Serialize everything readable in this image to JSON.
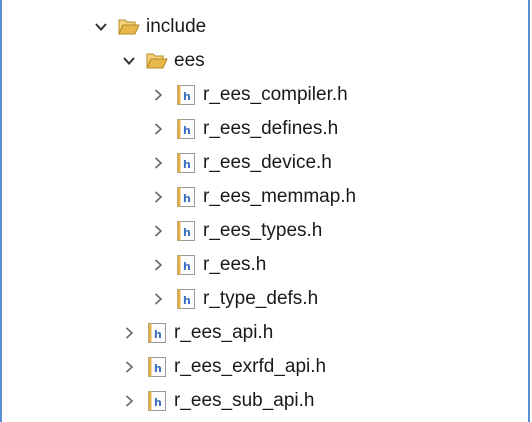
{
  "tree": {
    "folder_include": "include",
    "folder_ees": "ees",
    "ees_files": [
      "r_ees_compiler.h",
      "r_ees_defines.h",
      "r_ees_device.h",
      "r_ees_memmap.h",
      "r_ees_types.h",
      "r_ees.h",
      "r_type_defs.h"
    ],
    "include_files": [
      "r_ees_api.h",
      "r_ees_exrfd_api.h",
      "r_ees_sub_api.h"
    ]
  },
  "colors": {
    "border": "#5a8fd6",
    "folder": "#e8b84a",
    "header_icon": "#3a6fbf"
  },
  "icons": {
    "expanded": "chevron-down-icon",
    "collapsed": "chevron-right-icon",
    "folder": "folder-open-icon",
    "header_file": "header-file-icon"
  }
}
